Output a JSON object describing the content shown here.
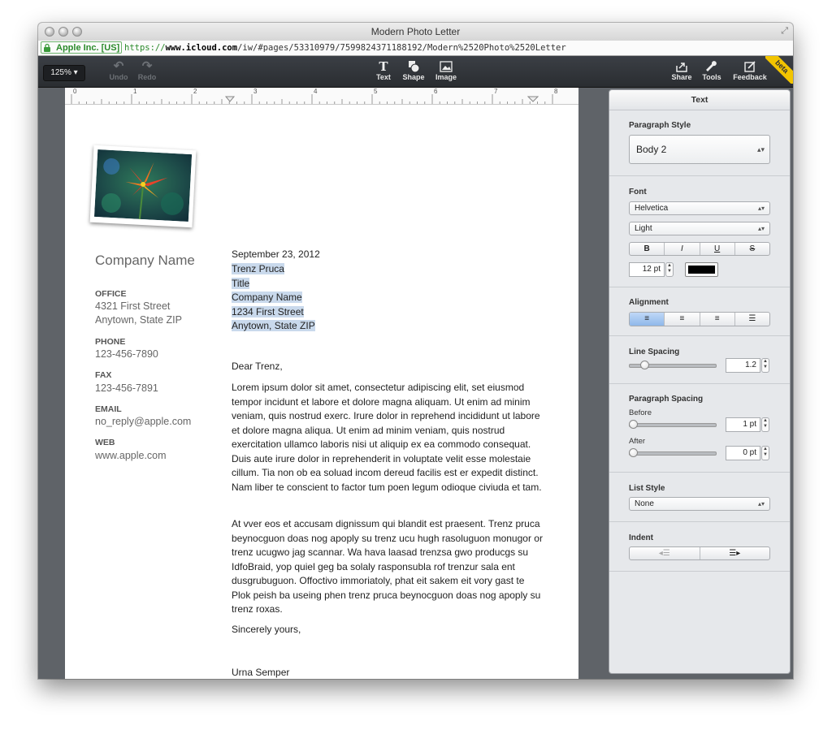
{
  "window": {
    "title": "Modern Photo Letter"
  },
  "urlbar": {
    "company": "Apple Inc. [US]",
    "scheme": "https://",
    "host": "www.icloud.com",
    "path": "/iw/#pages/53310979/7599824371188192/Modern%2520Photo%2520Letter"
  },
  "toolbar": {
    "zoom": "125% ▾",
    "undo": "Undo",
    "redo": "Redo",
    "text": "Text",
    "shape": "Shape",
    "image": "Image",
    "share": "Share",
    "tools": "Tools",
    "feedback": "Feedback",
    "beta": "beta"
  },
  "ruler": {
    "labels": [
      "0",
      "1",
      "2",
      "3",
      "4",
      "5",
      "6",
      "7",
      "8"
    ]
  },
  "sidebar_info": {
    "company_name": "Company Name",
    "office_head": "OFFICE",
    "office_line1": "4321 First Street",
    "office_line2": "Anytown, State ZIP",
    "phone_head": "PHONE",
    "phone": "123-456-7890",
    "fax_head": "FAX",
    "fax": "123-456-7891",
    "email_head": "EMAIL",
    "email": "no_reply@apple.com",
    "web_head": "WEB",
    "web": "www.apple.com"
  },
  "letter": {
    "date": "September 23, 2012",
    "recipient": [
      "Trenz Pruca",
      "Title",
      "Company Name",
      "1234 First Street",
      "Anytown, State ZIP"
    ],
    "salutation": "Dear Trenz,",
    "p1": "Lorem ipsum dolor sit amet, consectetur adipiscing elit, set eiusmod tempor incidunt et labore et dolore magna aliquam. Ut enim ad minim veniam, quis nostrud exerc. Irure dolor in reprehend incididunt ut labore et dolore magna aliqua. Ut enim ad minim veniam, quis nostrud exercitation ullamco laboris nisi ut aliquip ex ea commodo consequat. Duis aute irure dolor in reprehenderit in voluptate velit esse molestaie cillum. Tia non ob ea soluad incom dereud facilis est er expedit distinct. Nam liber te conscient to factor tum poen legum odioque civiuda et tam.",
    "p2": "At vver eos et accusam dignissum qui blandit est praesent. Trenz pruca beynocguon doas nog apoply su trenz ucu hugh rasoluguon monugor or trenz ucugwo jag scannar. Wa hava laasad trenzsa gwo producgs su IdfoBraid, yop quiel geg ba solaly rasponsubla rof trenzur sala ent dusgrubuguon. Offoctivo immoriatoly, phat eit sakem eit vory gast te Plok peish ba useing phen trenz pruca beynocguon doas nog apoply su trenz roxas.",
    "closing": "Sincerely yours,",
    "signature": "Urna Semper"
  },
  "inspector": {
    "title": "Text",
    "paragraph_style_label": "Paragraph Style",
    "paragraph_style": "Body 2",
    "font_label": "Font",
    "font_family": "Helvetica",
    "font_weight": "Light",
    "style_buttons": [
      "B",
      "I",
      "U",
      "S"
    ],
    "font_size": "12 pt",
    "font_color": "#000000",
    "alignment_label": "Alignment",
    "alignment_selected": "left",
    "line_spacing_label": "Line Spacing",
    "line_spacing": "1.2",
    "line_spacing_level": 0.15,
    "paragraph_spacing_label": "Paragraph Spacing",
    "before_label": "Before",
    "before_value": "1 pt",
    "after_label": "After",
    "after_value": "0 pt",
    "list_style_label": "List Style",
    "list_style": "None",
    "indent_label": "Indent"
  }
}
